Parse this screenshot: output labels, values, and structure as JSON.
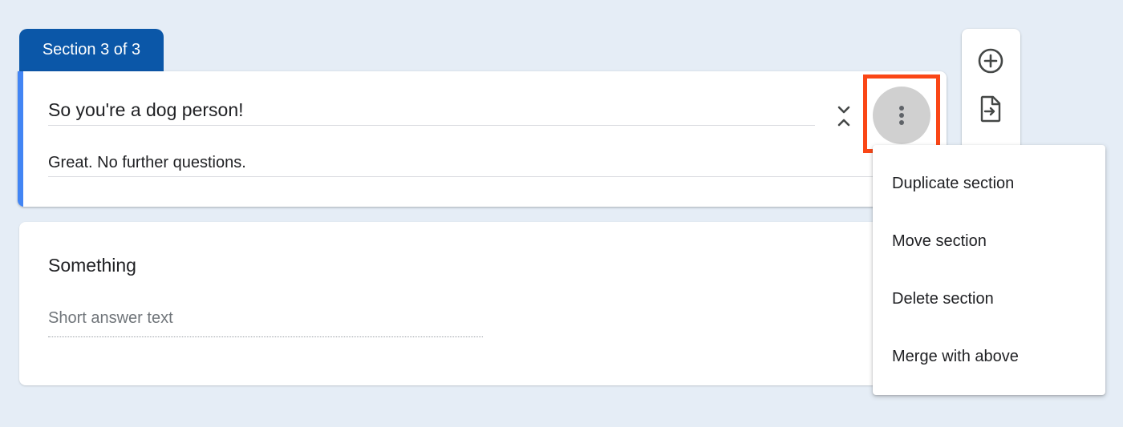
{
  "section": {
    "tab_label": "Section 3 of 3",
    "title": "So you're a dog person!",
    "description": "Great. No further questions."
  },
  "question": {
    "title": "Something",
    "placeholder": "Short answer text"
  },
  "menu": {
    "items": [
      {
        "label": "Duplicate section"
      },
      {
        "label": "Move section"
      },
      {
        "label": "Delete section"
      },
      {
        "label": "Merge with above"
      }
    ]
  },
  "icons": {
    "collapse": "collapse-icon",
    "more": "more-vert-icon",
    "add_question": "add-circle-icon",
    "import_questions": "import-icon"
  },
  "colors": {
    "background": "#e5edf6",
    "section_tab": "#0b57a8",
    "accent": "#4285f4",
    "highlight": "#fa4616"
  }
}
